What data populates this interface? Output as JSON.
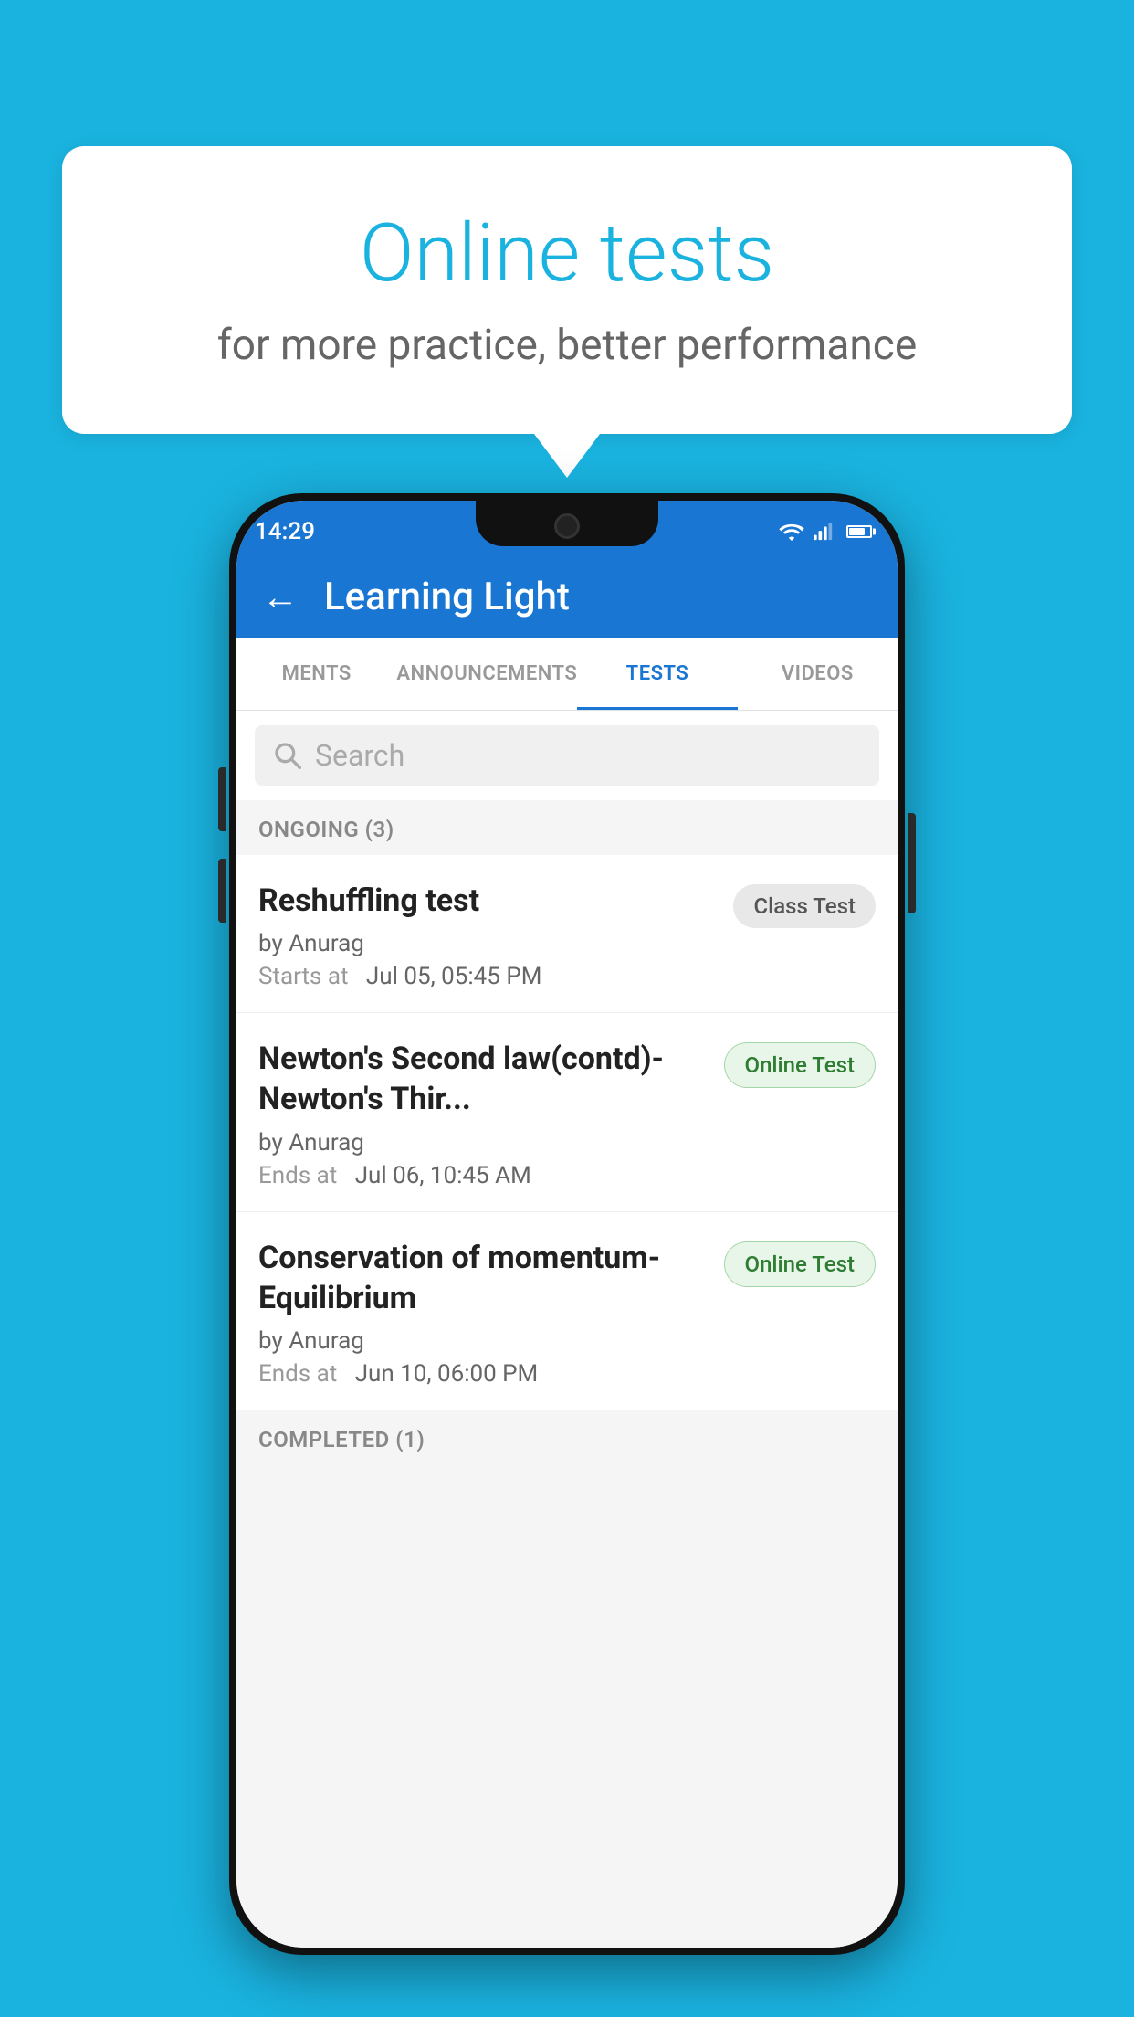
{
  "background": {
    "color": "#1ab3e0"
  },
  "speech_bubble": {
    "title": "Online tests",
    "subtitle": "for more practice, better performance"
  },
  "status_bar": {
    "time": "14:29",
    "icons": [
      "wifi",
      "signal",
      "battery"
    ]
  },
  "app_bar": {
    "back_label": "←",
    "title": "Learning Light"
  },
  "tabs": [
    {
      "label": "MENTS",
      "active": false
    },
    {
      "label": "ANNOUNCEMENTS",
      "active": false
    },
    {
      "label": "TESTS",
      "active": true
    },
    {
      "label": "VIDEOS",
      "active": false
    }
  ],
  "search": {
    "placeholder": "Search"
  },
  "ongoing_section": {
    "title": "ONGOING (3)"
  },
  "tests": [
    {
      "name": "Reshuffling test",
      "by": "by Anurag",
      "time_label": "Starts at",
      "time_value": "Jul 05, 05:45 PM",
      "badge": "Class Test",
      "badge_type": "class"
    },
    {
      "name": "Newton's Second law(contd)-Newton's Thir...",
      "by": "by Anurag",
      "time_label": "Ends at",
      "time_value": "Jul 06, 10:45 AM",
      "badge": "Online Test",
      "badge_type": "online"
    },
    {
      "name": "Conservation of momentum-Equilibrium",
      "by": "by Anurag",
      "time_label": "Ends at",
      "time_value": "Jun 10, 06:00 PM",
      "badge": "Online Test",
      "badge_type": "online"
    }
  ],
  "completed_section": {
    "title": "COMPLETED (1)"
  }
}
